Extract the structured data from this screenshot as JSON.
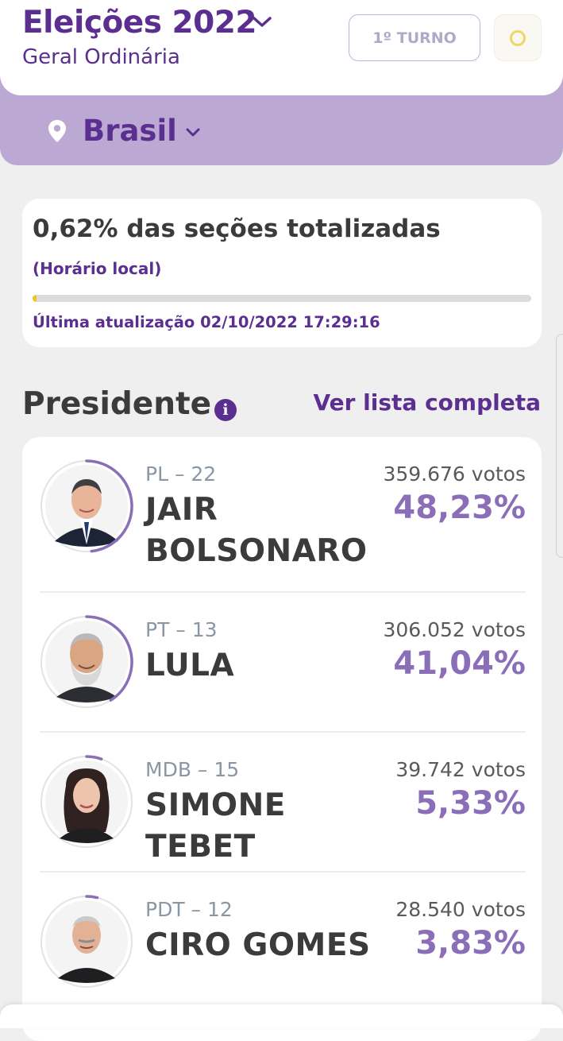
{
  "header": {
    "title": "Eleições 2022",
    "subtitle": "Geral Ordinária",
    "turno_label": "1º TURNO",
    "location": "Brasil"
  },
  "status": {
    "totalized": "0,62% das seções totalizadas",
    "local_time": "(Horário local)",
    "progress": 0.0062,
    "last_update": "Última atualização 02/10/2022 17:29:16"
  },
  "section": {
    "title": "Presidente",
    "link": "Ver lista completa"
  },
  "candidates": [
    {
      "party": "PL – 22",
      "name": "JAIR BOLSONARO",
      "votes": "359.676 votos",
      "pct": "48,23%",
      "share": 0.4823
    },
    {
      "party": "PT – 13",
      "name": "LULA",
      "votes": "306.052 votos",
      "pct": "41,04%",
      "share": 0.4104
    },
    {
      "party": "MDB – 15",
      "name": "SIMONE TEBET",
      "votes": "39.742 votos",
      "pct": "5,33%",
      "share": 0.0533
    },
    {
      "party": "PDT – 12",
      "name": "CIRO GOMES",
      "votes": "28.540 votos",
      "pct": "3,83%",
      "share": 0.0383
    }
  ],
  "colors": {
    "brand_purple": "#5b2f90",
    "lavender": "#bba9d4",
    "percent_purple": "#8a6fb8",
    "progress_yellow": "#f0c419"
  },
  "icons": [
    "chevron-down-icon",
    "location-pin-icon",
    "loading-ring-icon",
    "info-icon"
  ]
}
